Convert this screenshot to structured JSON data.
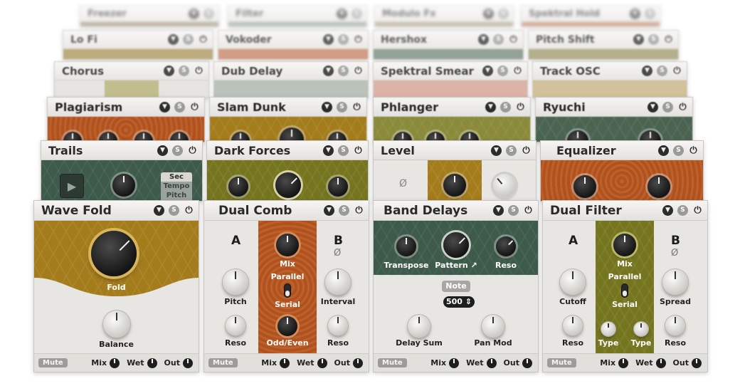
{
  "colors": {
    "orange": "#b9561f",
    "olive": "#75751f",
    "mustard": "#a47c1c",
    "green": "#3d5a4a",
    "salmon": "#c57b5c",
    "sage": "#7b8a6e"
  },
  "header_icons": [
    "chevron-down-icon",
    "solo-icon",
    "power-icon"
  ],
  "header_icon_glyphs": {
    "chevron": "▼",
    "solo": "S",
    "power": "⏻"
  },
  "rows": {
    "row0": [
      "Freezer",
      "Filter",
      "Modulo Fx",
      "Spektral Hold"
    ],
    "row1": [
      "Lo Fi",
      "Vokoder",
      "Hershox",
      "Pitch Shift"
    ],
    "row2": [
      "Chorus",
      "Dub Delay",
      "Spektral Smear",
      "Track OSC"
    ],
    "row3": [
      "Plagiarism",
      "Slam Dunk",
      "Phlanger",
      "Ryuchi"
    ],
    "row4": [
      "Trails",
      "Dark Forces",
      "Level",
      "Equalizer"
    ]
  },
  "trails": {
    "options": [
      "Sec",
      "Tempo",
      "Pitch"
    ]
  },
  "level": {
    "phase_symbol": "Ø"
  },
  "front": {
    "wave_fold": {
      "title": "Wave Fold",
      "knobs": {
        "fold": "Fold",
        "balance": "Balance"
      }
    },
    "dual_comb": {
      "title": "Dual Comb",
      "a": "A",
      "b": "B",
      "phase_symbol": "Ø",
      "knobs": {
        "mix": "Mix",
        "pitch": "Pitch",
        "interval": "Interval",
        "reso_a": "Reso",
        "reso_b": "Reso",
        "odd_even": "Odd/Even"
      },
      "switch": {
        "top": "Parallel",
        "bottom": "Serial"
      }
    },
    "band_delays": {
      "title": "Band Delays",
      "knobs": {
        "transpose": "Transpose",
        "pattern": "Pattern ↗",
        "reso": "Reso",
        "delay_sum": "Delay Sum",
        "pan_mod": "Pan Mod"
      },
      "note_button": "Note",
      "value_field": "500 ⇕"
    },
    "dual_filter": {
      "title": "Dual Filter",
      "a": "A",
      "b": "B",
      "phase_symbol": "Ø",
      "knobs": {
        "mix": "Mix",
        "cutoff": "Cutoff",
        "spread": "Spread",
        "reso_a": "Reso",
        "reso_b": "Reso",
        "type_a": "Type",
        "type_b": "Type"
      },
      "switch": {
        "top": "Parallel",
        "bottom": "Serial"
      }
    }
  },
  "footer": {
    "mute": "Mute",
    "mix": "Mix",
    "wet": "Wet",
    "out": "Out"
  }
}
